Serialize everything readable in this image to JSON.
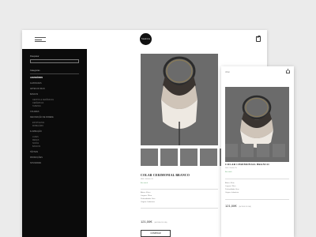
{
  "brand": {
    "logo_text": "SAALA"
  },
  "desktop": {
    "sidebar": {
      "search_label": "Pesquisar",
      "categories_title": "Categorias",
      "items": [
        {
          "label": "ACESSÓRIOS",
          "active": true
        },
        {
          "label": "ALMOFADAS"
        },
        {
          "label": "ARTES DO IRAN"
        },
        {
          "label": "BANCOS"
        },
        {
          "label": "CESTOS & CERÂMICAS"
        },
        {
          "label": "CERÂMICAS"
        },
        {
          "label": "TAPETES"
        },
        {
          "label": "COLARES"
        },
        {
          "label": "DECORAÇÃO DE PAREDE"
        },
        {
          "label": "ESTATUETAS"
        },
        {
          "label": "MOBILIÁRIO"
        },
        {
          "label": "ILUMINAÇÃO"
        },
        {
          "label": "LUZES"
        },
        {
          "label": "MESAS"
        },
        {
          "label": "SOFÁS"
        },
        {
          "label": "BANCOS"
        },
        {
          "label": "TÊXTEIS"
        },
        {
          "label": "PROMOÇÕES"
        },
        {
          "label": "NOVIDADES"
        }
      ]
    },
    "product": {
      "title": "COLAR CERIMONIAL BRANCO",
      "ref": "REF: 95040-CN",
      "stock": "Em stock",
      "specs": [
        "Altura: 40cm",
        "Largura: 28cm",
        "Profundidade: 8cm",
        "Origem: Indonésia"
      ],
      "price": "121,00€",
      "vat": "(ACRESCE IVA)",
      "buy_label": "COMPRAR"
    }
  },
  "mobile": {
    "back_label": "Voltar",
    "product": {
      "title": "COLAR CERIMONIAL BRANCO",
      "ref": "REF: 95040-CN",
      "stock": "Em stock",
      "specs": [
        "Altura: 40cm",
        "Largura: 28cm",
        "Profundidade: 8cm",
        "Origem: Indonésia"
      ],
      "price": "121,00€",
      "vat": "(ACRESCE IVA)"
    }
  },
  "colors": {
    "sidebar_bg": "#0b0b0b",
    "photo_bg": "#6b6b6b",
    "accent_stock": "#5aa469"
  },
  "icons": [
    "menu-icon",
    "bag-icon",
    "search-icon",
    "share-icon"
  ]
}
